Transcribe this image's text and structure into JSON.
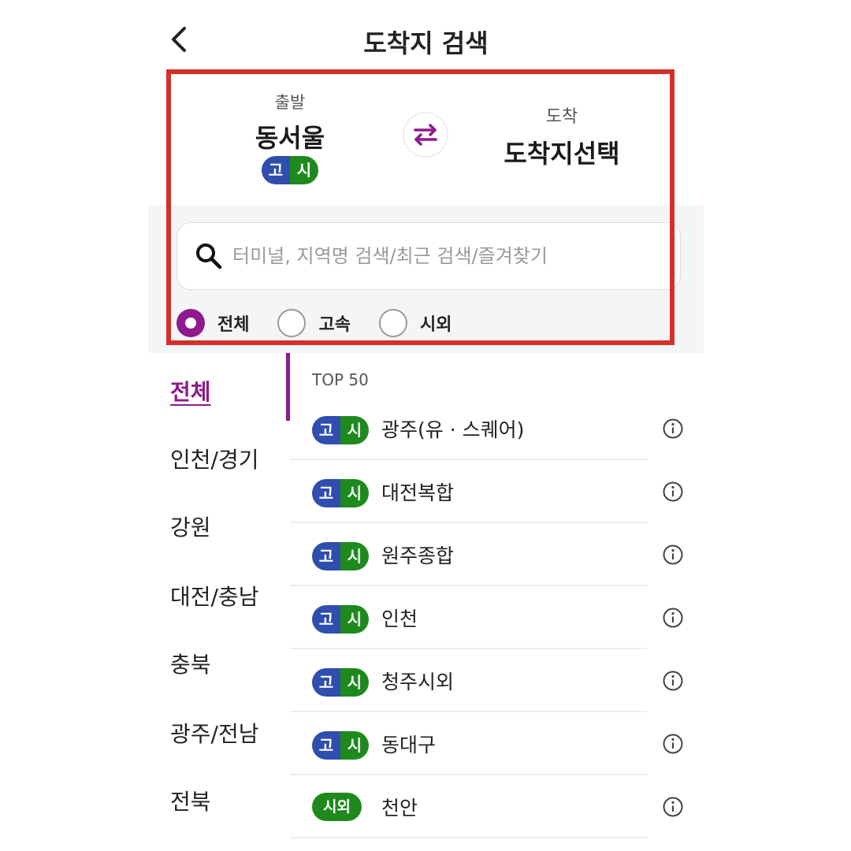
{
  "header": {
    "title": "도착지 검색",
    "back_icon": "chevron-left-icon"
  },
  "route": {
    "departure": {
      "label": "출발",
      "name": "동서울",
      "badge": [
        "고",
        "시"
      ]
    },
    "arrival": {
      "label": "도착",
      "name": "도착지선택"
    },
    "swap_icon": "swap-arrows-icon"
  },
  "search": {
    "placeholder": "터미널, 지역명 검색/최근 검색/즐겨찾기",
    "value": "",
    "filters": [
      {
        "label": "전체",
        "selected": true
      },
      {
        "label": "고속",
        "selected": false
      },
      {
        "label": "시외",
        "selected": false
      }
    ]
  },
  "sidebar": {
    "items": [
      {
        "label": "전체",
        "active": true
      },
      {
        "label": "인천/경기",
        "active": false
      },
      {
        "label": "강원",
        "active": false
      },
      {
        "label": "대전/충남",
        "active": false
      },
      {
        "label": "충북",
        "active": false
      },
      {
        "label": "광주/전남",
        "active": false
      },
      {
        "label": "전북",
        "active": false
      }
    ]
  },
  "list": {
    "header": "TOP 50",
    "rows": [
      {
        "badge": [
          "고",
          "시"
        ],
        "name": "광주(유 · 스퀘어)"
      },
      {
        "badge": [
          "고",
          "시"
        ],
        "name": "대전복합"
      },
      {
        "badge": [
          "고",
          "시"
        ],
        "name": "원주종합"
      },
      {
        "badge": [
          "고",
          "시"
        ],
        "name": "인천"
      },
      {
        "badge": [
          "고",
          "시"
        ],
        "name": "청주시외"
      },
      {
        "badge": [
          "고",
          "시"
        ],
        "name": "동대구"
      },
      {
        "badge": [
          "시외"
        ],
        "name": "천안"
      }
    ]
  },
  "colors": {
    "accent": "#8e1a8e",
    "express_badge": "#2f4eae",
    "intercity_badge": "#1e8a1e",
    "highlight_box": "#d3302a"
  }
}
